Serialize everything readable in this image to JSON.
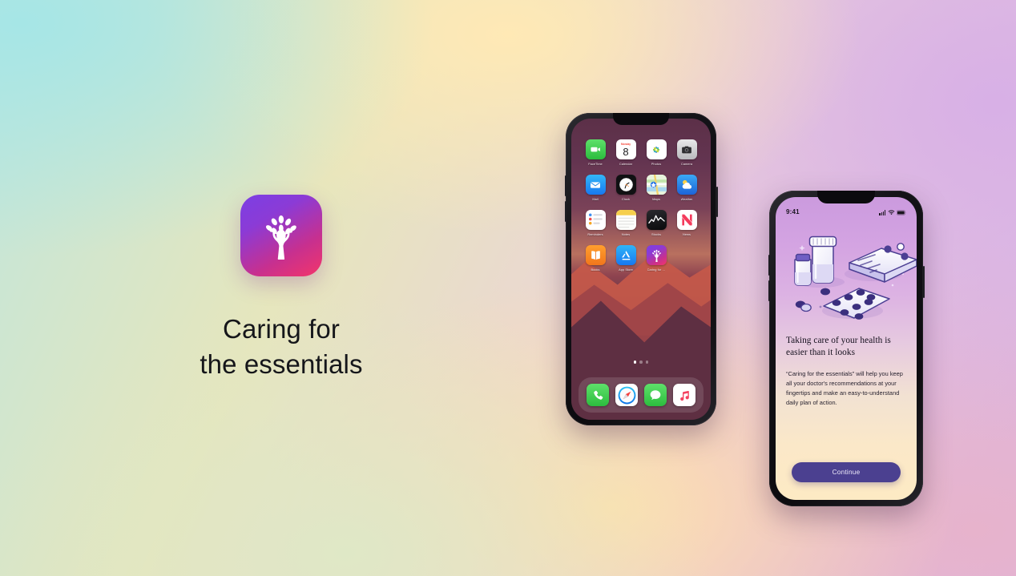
{
  "brand": {
    "logo_icon": "tree-hand-logo-icon",
    "title_line1": "Caring for",
    "title_line2": "the essentials",
    "gradient_from": "#7b3fe4",
    "gradient_to": "#f3356a"
  },
  "background": {
    "corner_top_left": "#a6e6e6",
    "corner_top_right": "#d8b0e6",
    "corner_bottom_left": "#dfe8c6",
    "corner_bottom_right": "#e7b3cc",
    "center": "#ffe9b5"
  },
  "home_phone": {
    "device": "iphone",
    "wallpaper": "mountain-ridges-dusk",
    "apps": [
      {
        "label": "FaceTime",
        "icon": "facetime-icon"
      },
      {
        "label": "Calendar",
        "icon": "calendar-icon",
        "weekday": "Monday",
        "day": "8"
      },
      {
        "label": "Photos",
        "icon": "photos-icon"
      },
      {
        "label": "Camera",
        "icon": "camera-icon"
      },
      {
        "label": "Mail",
        "icon": "mail-icon"
      },
      {
        "label": "Clock",
        "icon": "clock-icon"
      },
      {
        "label": "Maps",
        "icon": "maps-icon"
      },
      {
        "label": "Weather",
        "icon": "weather-icon"
      },
      {
        "label": "Reminders",
        "icon": "reminders-icon"
      },
      {
        "label": "Notes",
        "icon": "notes-icon"
      },
      {
        "label": "Stocks",
        "icon": "stocks-icon"
      },
      {
        "label": "News",
        "icon": "news-icon"
      },
      {
        "label": "Books",
        "icon": "books-icon"
      },
      {
        "label": "App Store",
        "icon": "app-store-icon"
      },
      {
        "label": "Caring for …",
        "icon": "caring-for-app-icon"
      }
    ],
    "page_dots": {
      "count": 3,
      "active_index": 0
    },
    "dock": [
      {
        "label": "Phone",
        "icon": "phone-icon"
      },
      {
        "label": "Safari",
        "icon": "safari-icon"
      },
      {
        "label": "Messages",
        "icon": "messages-icon"
      },
      {
        "label": "Music",
        "icon": "music-icon"
      }
    ]
  },
  "app_phone": {
    "device": "iphone",
    "status_bar": {
      "time": "9:41",
      "cellular_icon": "signal-bars-icon",
      "wifi_icon": "wifi-icon",
      "battery_icon": "battery-full-icon"
    },
    "illustration": "medicine-bottles-blister-pack-illustration",
    "headline": "Taking care of your health is easier than it looks",
    "body": "“Caring for the essentials” will help you keep all your doctor's recommendations at your fingertips and make an easy-to-understand daily plan of action.",
    "cta_label": "Continue",
    "cta_color": "#4b4090",
    "screen_gradient_top": "#cb9ade",
    "screen_gradient_bottom": "#fdeac4"
  }
}
